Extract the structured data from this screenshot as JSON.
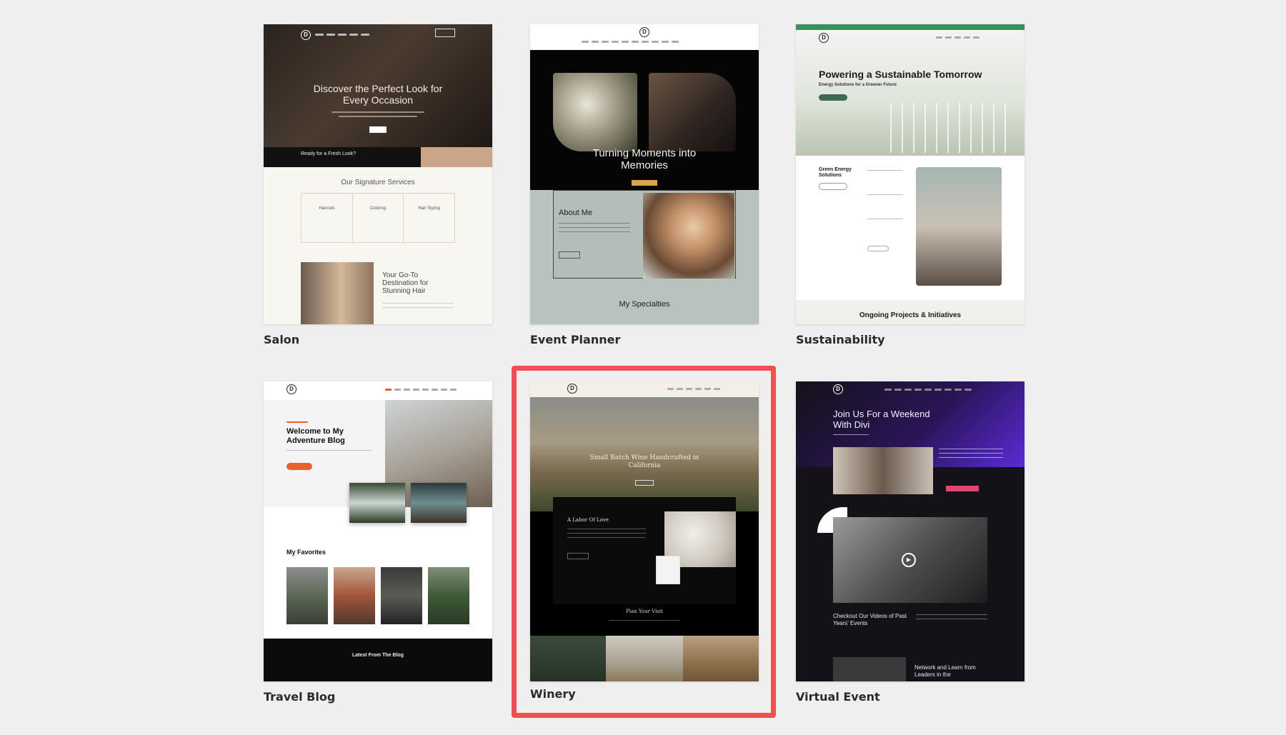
{
  "layouts": [
    {
      "caption": "Salon",
      "hero_title": "Discover the Perfect Look for Every Occasion",
      "cta_band": "Ready for a Fresh Look?",
      "section_title": "Our Signature Services",
      "services": [
        "Haircuts",
        "Coloring",
        "Hair Styling"
      ],
      "feature_title": "Your Go-To Destination for Stunning Hair"
    },
    {
      "caption": "Event Planner",
      "hero_title": "Turning Moments into Memories",
      "about_title": "About Me",
      "section_title": "My Specialties"
    },
    {
      "caption": "Sustainability",
      "hero_title": "Powering a Sustainable Tomorrow",
      "hero_sub": "Energy Solutions for a Greener Future",
      "feature_title": "Green Energy Solutions",
      "section_title": "Ongoing Projects & Initiatives"
    },
    {
      "caption": "Travel Blog",
      "hero_title": "Welcome to My Adventure Blog",
      "section_title": "My Favorites",
      "footer_title": "Latest From The Blog"
    },
    {
      "caption": "Winery",
      "hero_title": "Small Batch Wine Handcrafted in California",
      "about_title": "A Labor Of Love",
      "section_title": "Plan Your Visit"
    },
    {
      "caption": "Virtual Event",
      "hero_title": "Join Us For a Weekend With Divi",
      "video_title": "Checkout Our Videos of Past Years' Events",
      "footer_title": "Network and Learn from Leaders in the"
    }
  ],
  "logo_letter": "D",
  "selected_index": 4,
  "colors": {
    "background": "#efefef",
    "selected_border": "#ef4f52",
    "salon_accent": "#c9a58a",
    "sustain_green": "#3d6b4f",
    "travel_orange": "#e8622c",
    "event_gold": "#d8a64a",
    "virtual_purple": "#5a2bd6",
    "virtual_pink": "#e0476b"
  }
}
